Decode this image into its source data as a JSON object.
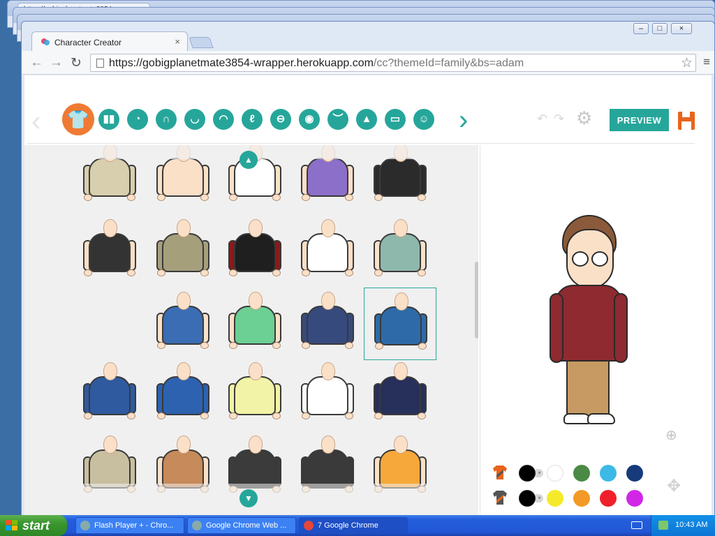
{
  "background_windows": [
    {
      "tab_title": "https://gobigplanetmate3854..."
    },
    {
      "tab_title": ""
    },
    {
      "tab_title": ""
    }
  ],
  "window": {
    "tab_title": "Character Creator",
    "tab_close": "×",
    "minimize": "–",
    "maximize": "□",
    "close": "×"
  },
  "toolbar": {
    "back": "←",
    "forward": "→",
    "reload": "↻",
    "url_host": "https://gobigplanetmate3854-wrapper.herokuapp.com",
    "url_path": "/cc?themeId=family&bs=adam",
    "star": "☆",
    "menu": "≡"
  },
  "creator": {
    "prev": "‹",
    "next": "›",
    "undo": "↶",
    "redo": "↷",
    "settings": "⚙",
    "preview_label": "PREVIEW",
    "categories": [
      {
        "name": "upper-body",
        "glyph": "👕"
      },
      {
        "name": "lower-body",
        "glyph": "▮▮"
      },
      {
        "name": "face-shape",
        "glyph": "◔"
      },
      {
        "name": "hair",
        "glyph": "∩"
      },
      {
        "name": "head",
        "glyph": "◡"
      },
      {
        "name": "mouth",
        "glyph": "◠"
      },
      {
        "name": "ear",
        "glyph": "ℓ"
      },
      {
        "name": "facial-hair",
        "glyph": "⊖"
      },
      {
        "name": "eye",
        "glyph": "◉"
      },
      {
        "name": "eyebrow",
        "glyph": "︶"
      },
      {
        "name": "nose",
        "glyph": "▲"
      },
      {
        "name": "glasses",
        "glyph": "▭"
      },
      {
        "name": "accessory",
        "glyph": "☺"
      }
    ],
    "scroll_up": "▲",
    "scroll_down": "▼",
    "zoom": "⊕",
    "move": "✥"
  },
  "outfits": [
    {
      "top": "#d7cfae",
      "arm": "#d7cfae",
      "skin_arms": false
    },
    {
      "top": "#fbe0c8",
      "arm": "#fbe0c8",
      "skin_arms": true
    },
    {
      "top": "#ffffff",
      "arm": "#fbe0c8",
      "skin_arms": true
    },
    {
      "top": "#8c6fc9",
      "arm": "#fbe0c8",
      "skin_arms": true
    },
    {
      "top": "#2b2b2b",
      "arm": "#2b2b2b",
      "skin_arms": false
    },
    {
      "top": "#333333",
      "arm": "#fbe0c8",
      "skin_arms": true
    },
    {
      "top": "#a69f7c",
      "arm": "#a69f7c",
      "skin_arms": false
    },
    {
      "top": "#1f1f1f",
      "arm": "#8a1a1a",
      "skin_arms": false
    },
    {
      "top": "#ffffff",
      "arm": "#fbe0c8",
      "skin_arms": true
    },
    {
      "top": "#8fb8ad",
      "arm": "#fbe0c8",
      "skin_arms": true
    },
    {
      "top": "#3a6db3",
      "arm": "#fbe0c8",
      "skin_arms": true
    },
    {
      "top": "#6ccf93",
      "arm": "#fbe0c8",
      "skin_arms": true
    },
    {
      "top": "#364a7d",
      "arm": "#364a7d",
      "skin_arms": false
    },
    {
      "top": "#2f6aa8",
      "arm": "#2f6aa8",
      "skin_arms": false
    },
    {
      "top": "#2f5aa0",
      "arm": "#2f5aa0",
      "skin_arms": false
    },
    {
      "top": "#2d62b0",
      "arm": "#2d62b0",
      "skin_arms": false
    },
    {
      "top": "#f2f3a6",
      "arm": "#f2f3a6",
      "skin_arms": false
    },
    {
      "top": "#ffffff",
      "arm": "#ffffff",
      "skin_arms": false
    },
    {
      "top": "#27305a",
      "arm": "#27305a",
      "skin_arms": false
    },
    {
      "top": "#c8bfa0",
      "arm": "#c8bfa0",
      "skin_arms": false
    },
    {
      "top": "#c78a5a",
      "arm": "#fbe0c8",
      "skin_arms": true
    },
    {
      "top": "#3b3b3b",
      "arm": "#3b3b3b",
      "skin_arms": false
    },
    {
      "top": "#3a3a3a",
      "arm": "#3a3a3a",
      "skin_arms": false
    },
    {
      "top": "#f6a93a",
      "arm": "#fbe0c8",
      "skin_arms": true
    }
  ],
  "colors": {
    "accent": "#26a69a",
    "active": "#f07a34",
    "save": "#e8641d",
    "hoodie": "#8e2a30"
  },
  "swatches": {
    "primary_part": "shirt-primary-color",
    "secondary_part": "shirt-secondary-color",
    "row1": [
      "#000000",
      "#ffffff",
      "#4a8a44",
      "#3db9e6",
      "#163a7a"
    ],
    "row2": [
      "#000000",
      "#f5ea2a",
      "#f29a25",
      "#f0202a",
      "#d126e6"
    ]
  },
  "taskbar": {
    "start": "start",
    "tasks": [
      {
        "label": "Flash Player + - Chro...",
        "active": false
      },
      {
        "label": "Google Chrome Web ...",
        "active": false
      },
      {
        "label": "7 Google Chrome",
        "active": true
      }
    ],
    "clock": "10:43 AM"
  }
}
